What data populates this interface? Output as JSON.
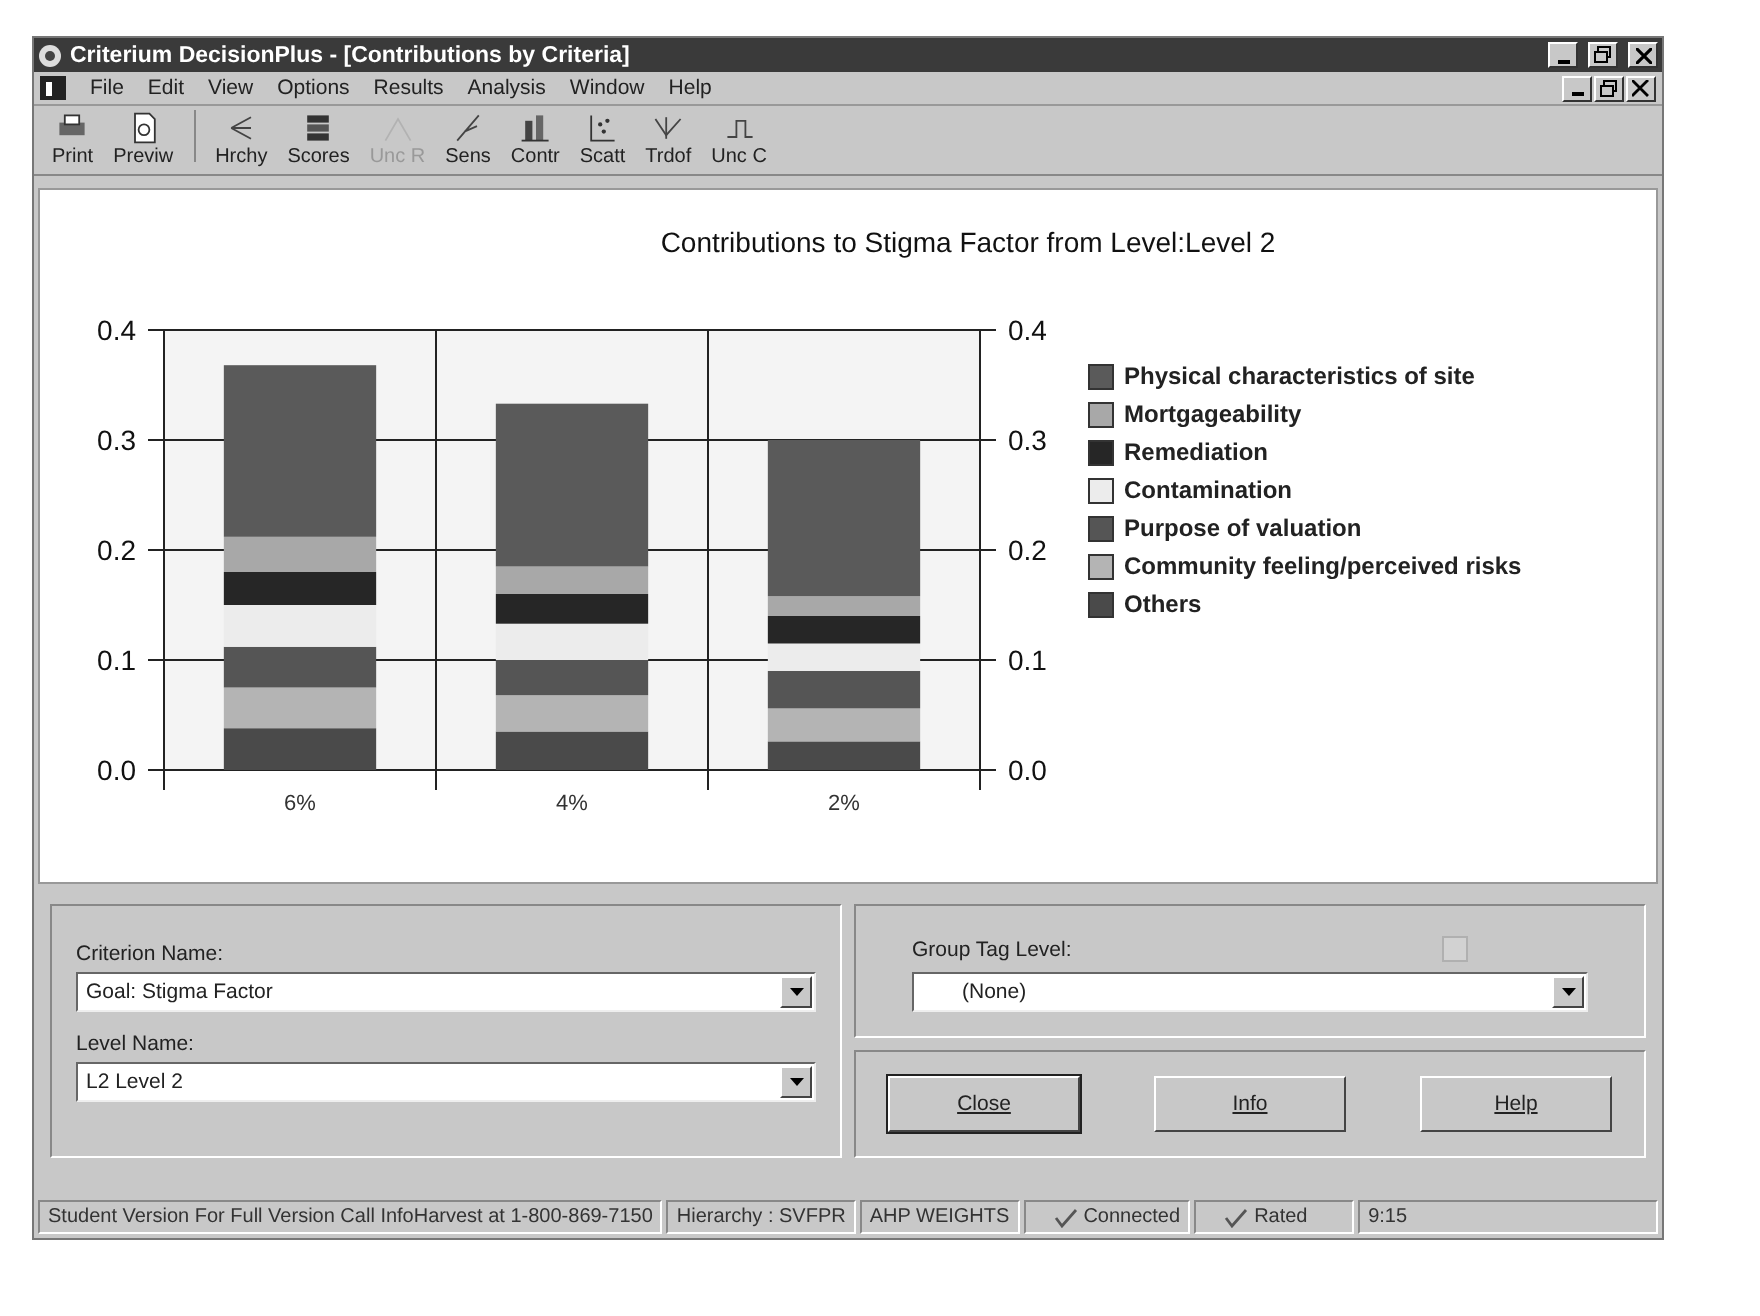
{
  "window": {
    "title": "Criterium DecisionPlus - [Contributions by Criteria]"
  },
  "menu": [
    {
      "label": "File",
      "disabled": false
    },
    {
      "label": "Edit",
      "disabled": false
    },
    {
      "label": "View",
      "disabled": false
    },
    {
      "label": "Options",
      "disabled": false
    },
    {
      "label": "Results",
      "disabled": false
    },
    {
      "label": "Analysis",
      "disabled": false
    },
    {
      "label": "Window",
      "disabled": false
    },
    {
      "label": "Help",
      "disabled": false
    }
  ],
  "toolbar": [
    {
      "label": "Print",
      "kind": "print",
      "disabled": false
    },
    {
      "label": "Previw",
      "kind": "preview",
      "disabled": false
    },
    {
      "label": "Hrchy",
      "kind": "hierarchy",
      "disabled": false
    },
    {
      "label": "Scores",
      "kind": "scores",
      "disabled": false
    },
    {
      "label": "Unc R",
      "kind": "uncr",
      "disabled": true
    },
    {
      "label": "Sens",
      "kind": "sens",
      "disabled": false
    },
    {
      "label": "Contr",
      "kind": "contr",
      "disabled": false
    },
    {
      "label": "Scatt",
      "kind": "scatt",
      "disabled": false
    },
    {
      "label": "Trdof",
      "kind": "trdof",
      "disabled": false
    },
    {
      "label": "Unc C",
      "kind": "uncc",
      "disabled": false
    }
  ],
  "chart": {
    "chart_data": {
      "type": "bar",
      "title": "Contributions to Stigma Factor from Level:Level 2",
      "stacked": true,
      "grid": true,
      "categories": [
        "6%",
        "4%",
        "2%"
      ],
      "ylim": [
        0,
        0.4
      ],
      "yticks": [
        {
          "value": 0,
          "label": "0.0"
        },
        {
          "value": 0.1,
          "label": "0.1"
        },
        {
          "value": 0.2,
          "label": "0.2"
        },
        {
          "value": 0.3,
          "label": "0.3"
        },
        {
          "value": 0.4,
          "label": "0.4"
        }
      ],
      "series": [
        {
          "name": "Others",
          "color": "#4a4a4a",
          "values": [
            0.038,
            0.035,
            0.026
          ]
        },
        {
          "name": "Community feeling/perceived risks",
          "color": "#b4b4b4",
          "values": [
            0.037,
            0.033,
            0.03
          ]
        },
        {
          "name": "Purpose of valuation",
          "color": "#555555",
          "values": [
            0.037,
            0.032,
            0.034
          ]
        },
        {
          "name": "Contamination",
          "color": "#ececec",
          "values": [
            0.038,
            0.033,
            0.025
          ]
        },
        {
          "name": "Remediation",
          "color": "#262626",
          "values": [
            0.03,
            0.027,
            0.025
          ]
        },
        {
          "name": "Mortgageability",
          "color": "#a8a8a8",
          "values": [
            0.032,
            0.025,
            0.018
          ]
        },
        {
          "name": "Physical characteristics of site",
          "color": "#5a5a5a",
          "values": [
            0.156,
            0.148,
            0.142
          ]
        }
      ]
    }
  },
  "criterion": {
    "label": "Criterion Name:",
    "value": "Goal: Stigma Factor"
  },
  "level": {
    "label": "Level Name:",
    "value": "L2 Level 2"
  },
  "group": {
    "label": "Group Tag Level:",
    "value": "(None)",
    "checkbox": {
      "checked": false,
      "disabled": true
    }
  },
  "buttons": [
    "Close",
    "Info",
    "Help"
  ],
  "status_bar": [
    "Student Version For Full Version Call InfoHarvest at 1-800-869-7150",
    "Hierarchy : SVFPR",
    "AHP WEIGHTS",
    "Connected",
    "Rated",
    "9:15"
  ]
}
